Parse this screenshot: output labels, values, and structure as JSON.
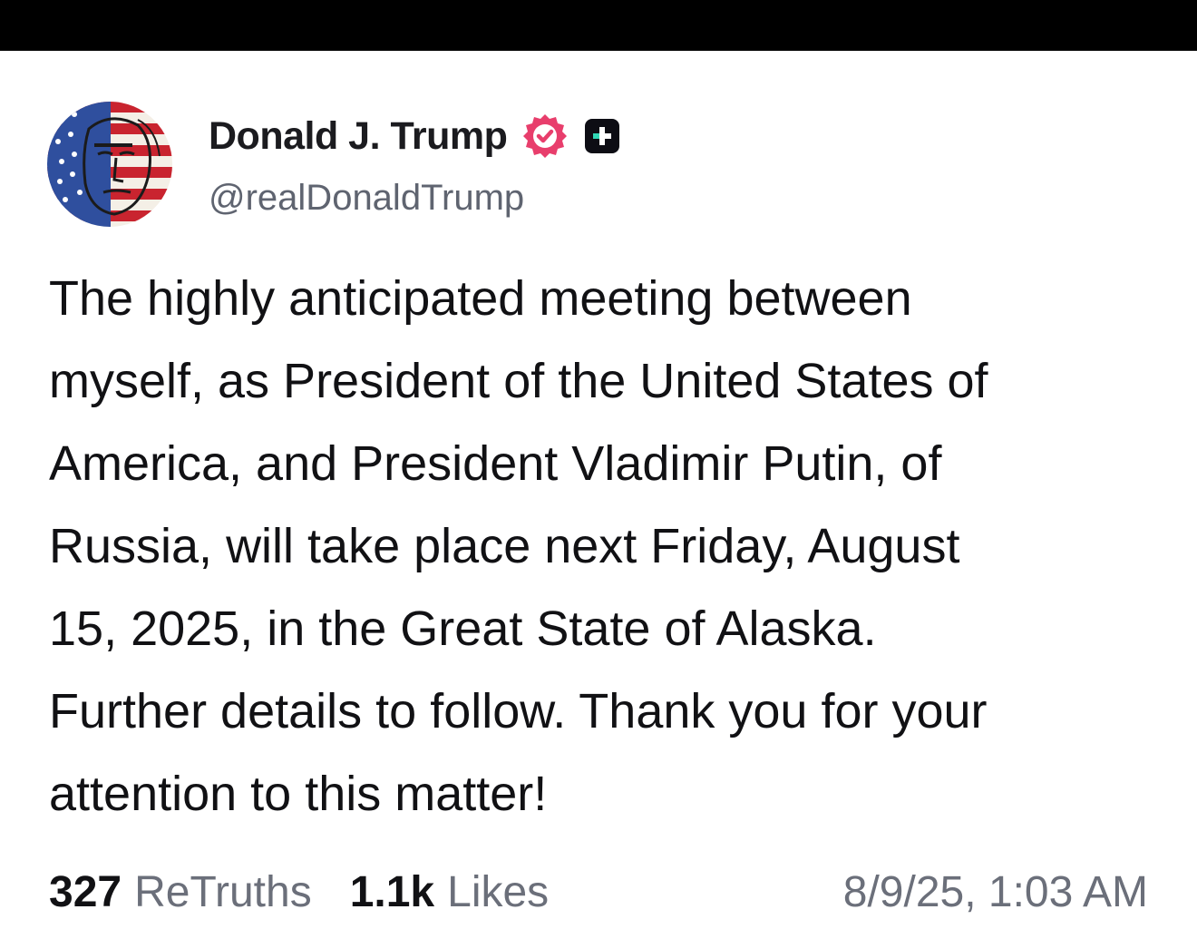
{
  "author": {
    "display_name": "Donald J. Trump",
    "handle": "@realDonaldTrump",
    "verified_icon": "verified-badge-icon",
    "plus_icon": "truth-plus-icon",
    "verified_color": "#e83e6c"
  },
  "post": {
    "lines": [
      "The highly anticipated meeting between",
      "myself, as President of the United States of",
      "America, and President Vladimir Putin, of",
      "Russia, will take place next Friday, August",
      "15, 2025, in the Great State of Alaska.",
      "Further details to follow. Thank you for your",
      "attention to this matter!"
    ]
  },
  "stats": {
    "retruths_count": "327",
    "retruths_label": "ReTruths",
    "likes_count": "1.1k",
    "likes_label": "Likes",
    "timestamp": "8/9/25, 1:03 AM"
  }
}
